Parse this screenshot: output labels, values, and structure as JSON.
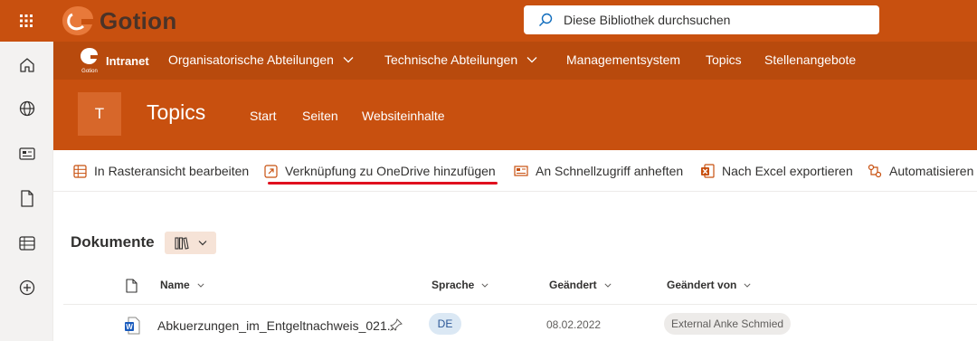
{
  "suite": {
    "brand_name": "Gotion",
    "search_placeholder": "Diese Bibliothek durchsuchen"
  },
  "rail": {
    "icons": [
      "home-icon",
      "globe-icon",
      "news-icon",
      "file-icon",
      "lists-icon",
      "create-icon"
    ]
  },
  "hubnav": {
    "brand_logo_text": "Gotion",
    "brand_label": "Intranet",
    "items": [
      {
        "label": "Organisatorische Abteilungen",
        "has_menu": true
      },
      {
        "label": "Technische Abteilungen",
        "has_menu": true
      },
      {
        "label": "Managementsystem",
        "has_menu": false
      },
      {
        "label": "Topics",
        "has_menu": false
      },
      {
        "label": "Stellenangebote",
        "has_menu": false
      }
    ]
  },
  "site": {
    "logo_letter": "T",
    "title": "Topics",
    "links": [
      "Start",
      "Seiten",
      "Websiteinhalte"
    ]
  },
  "commands": [
    {
      "label": "In Rasteransicht bearbeiten",
      "icon": "grid-edit-icon"
    },
    {
      "label": "Verknüpfung zu OneDrive hinzufügen",
      "icon": "open-link-icon"
    },
    {
      "label": "An Schnellzugriff anheften",
      "icon": "pin-quick-access-icon"
    },
    {
      "label": "Nach Excel exportieren",
      "icon": "excel-icon"
    },
    {
      "label": "Automatisieren",
      "icon": "automate-icon"
    }
  ],
  "library": {
    "title": "Dokumente",
    "columns": [
      "Name",
      "Sprache",
      "Geändert",
      "Geändert von"
    ],
    "rows": [
      {
        "name": "Abkuerzungen_im_Entgeltnachweis_021...",
        "language": "DE",
        "modified": "08.02.2022",
        "modified_by": "External Anke Schmied"
      }
    ]
  },
  "colors": {
    "suite_bar": "#c8500f",
    "hub_nav": "#b84a0d",
    "accent_highlight": "#e0101e"
  }
}
